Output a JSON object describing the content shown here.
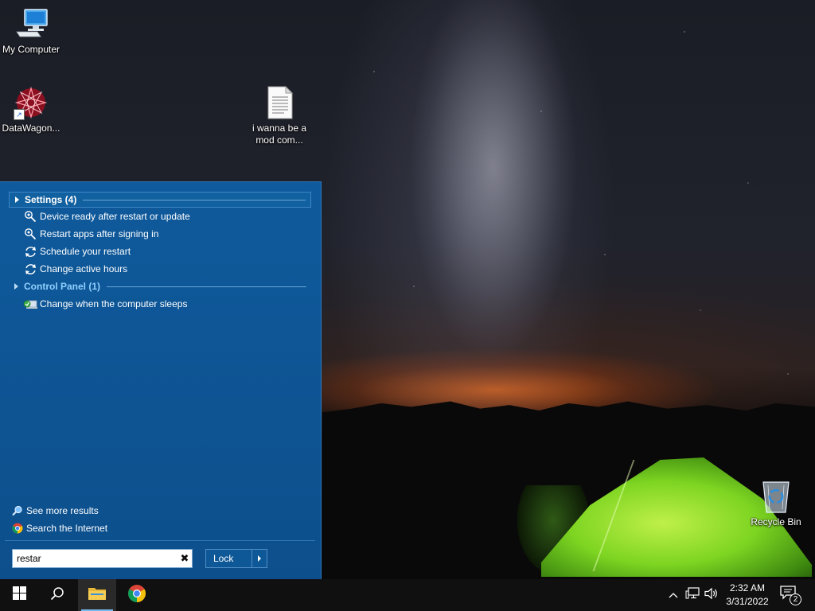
{
  "desktop": {
    "icons": [
      {
        "label": "My Computer",
        "icon": "computer-icon"
      },
      {
        "label": "DataWagon...",
        "icon": "datawagon-icon"
      },
      {
        "label": "i wanna be a mod com...",
        "icon": "text-document-icon"
      },
      {
        "label": "Recycle Bin",
        "icon": "recycle-bin-icon"
      }
    ]
  },
  "start_panel": {
    "groups": [
      {
        "header": "Settings (4)",
        "items": [
          {
            "label": "Device ready after restart or update",
            "icon": "settings-search-icon"
          },
          {
            "label": "Restart apps after signing in",
            "icon": "settings-search-icon"
          },
          {
            "label": "Schedule your restart",
            "icon": "sync-icon"
          },
          {
            "label": "Change active hours",
            "icon": "sync-icon"
          }
        ]
      },
      {
        "header": "Control Panel (1)",
        "items": [
          {
            "label": "Change when the computer sleeps",
            "icon": "power-options-icon"
          }
        ]
      }
    ],
    "see_more": "See more results",
    "search_internet": "Search the Internet",
    "search_value": "restar",
    "lock_label": "Lock"
  },
  "taskbar": {
    "apps": [
      {
        "name": "start-button",
        "icon": "windows-logo-icon"
      },
      {
        "name": "search-button",
        "icon": "search-icon"
      },
      {
        "name": "file-explorer",
        "icon": "folder-icon"
      },
      {
        "name": "chrome",
        "icon": "chrome-icon"
      }
    ],
    "time": "2:32 AM",
    "date": "3/31/2022",
    "notification_count": "2"
  },
  "colors": {
    "panel": "#0d4f8c",
    "taskbar": "#101010",
    "link": "#8fd0ff",
    "tent": "#7dd421"
  }
}
